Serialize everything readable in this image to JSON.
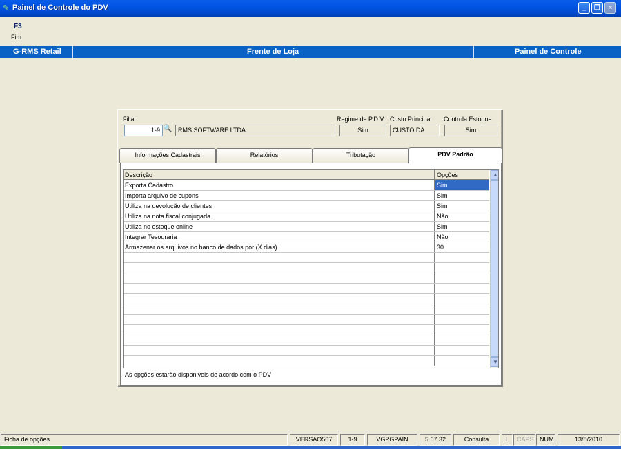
{
  "window": {
    "title": "Painel de Controle do PDV",
    "minimize": "_",
    "maximize": "❐",
    "close": "×"
  },
  "toolbar": {
    "fkey": "F3",
    "fkey_label": "Fim"
  },
  "header_band": {
    "left": "G-RMS Retail",
    "center": "Frente de Loja",
    "right": "Painel de Controle"
  },
  "form": {
    "filial_label": "Filial",
    "filial_value": "1-9",
    "filial_name": "RMS SOFTWARE LTDA.",
    "regime_label": "Regime de P.D.V.",
    "regime_value": "Sim",
    "custo_label": "Custo Principal",
    "custo_value": "CUSTO DA",
    "estoque_label": "Controla Estoque",
    "estoque_value": "Sim"
  },
  "tabs": [
    {
      "label": "Informações Cadastrais",
      "active": false
    },
    {
      "label": "Relatórios",
      "active": false
    },
    {
      "label": "Tributação",
      "active": false
    },
    {
      "label": "PDV Padrão",
      "active": true
    }
  ],
  "grid": {
    "columns": [
      "Descrição",
      "Opções"
    ],
    "rows": [
      {
        "descricao": "Exporta Cadastro",
        "opcao": "Sim"
      },
      {
        "descricao": "Importa arquivo de cupons",
        "opcao": "Sim"
      },
      {
        "descricao": "Utiliza na devolução de clientes",
        "opcao": "Sim"
      },
      {
        "descricao": "Utiliza na nota fiscal conjugada",
        "opcao": "Não"
      },
      {
        "descricao": "Utiliza no estoque online",
        "opcao": "Sim"
      },
      {
        "descricao": "Integrar Tesouraria",
        "opcao": "Não"
      },
      {
        "descricao": "Armazenar os arquivos no banco de dados por (X dias)",
        "opcao": "30"
      }
    ],
    "empty_rows": 11,
    "selected_row": 0
  },
  "note": "As opções estarão disponiveis de acordo com o PDV",
  "statusbar": {
    "message": "Ficha de opções",
    "versao": "VERSAO567",
    "filial": "1-9",
    "user": "VGPGPAIN",
    "build": "5.67.32",
    "mode": "Consulta",
    "l": "L",
    "caps": "CAPS",
    "num": "NUM",
    "date": "13/8/2010"
  }
}
